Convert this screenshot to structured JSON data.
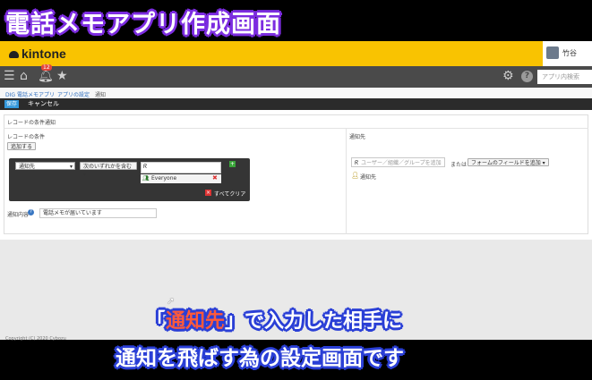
{
  "video": {
    "title": "電話メモアプリ作成画面",
    "subtitle_line1_prefix": "「",
    "subtitle_line1_highlight": "通知先",
    "subtitle_line1_suffix": "」で入力した相手に",
    "subtitle_line2": "通知を飛ばす為の設定画面です"
  },
  "header": {
    "logo": "kintone",
    "user_name": "竹谷",
    "notification_count": "12",
    "search_placeholder": "アプリ内検索"
  },
  "breadcrumb": [
    "DIG 電話メモアプリ",
    "アプリの設定",
    "通知"
  ],
  "actions": {
    "save": "保存",
    "cancel": "キャンセル"
  },
  "section": {
    "title": "レコードの条件通知",
    "col_condition": "レコードの条件",
    "col_recipient": "通知先",
    "add_button": "追加する"
  },
  "condition": {
    "field_select": "通知先",
    "operator_select": "次のいずれかを含む",
    "value_input": "",
    "value_tag": "Everyone",
    "clear_all": "すべてクリア"
  },
  "notify_content": {
    "label": "通知内容",
    "value": "電話メモが届いています"
  },
  "recipient": {
    "input_placeholder": "ユーザー／組織／グループを追加",
    "or_text": "または",
    "form_field_button": "フォームのフィールドを追加",
    "entry": "通知先"
  },
  "footer": {
    "copyright": "Copyright (C) 2020 Cybozu"
  }
}
